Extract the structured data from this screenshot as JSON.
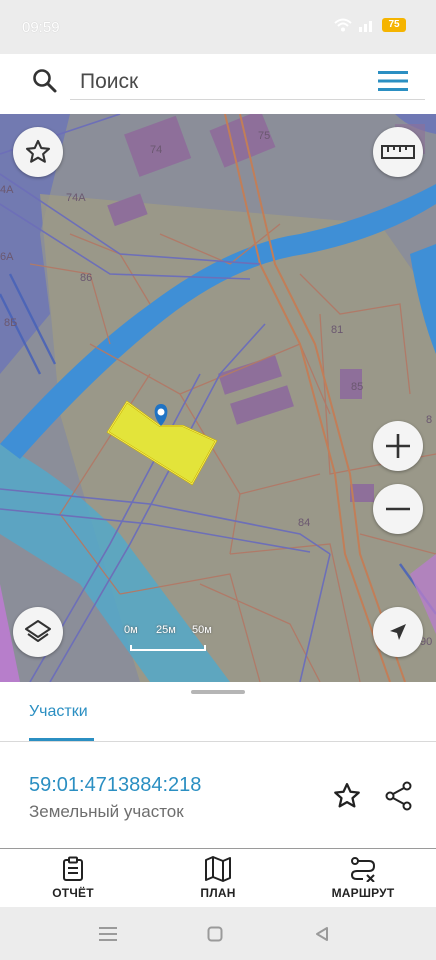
{
  "status_bar": {
    "time": "09:59",
    "battery": "75",
    "icons": [
      "wifi-icon",
      "signal-icon",
      "battery-icon"
    ]
  },
  "search": {
    "placeholder": "Поиск",
    "icon": "search-icon",
    "menu_icon": "hamburger-menu-icon"
  },
  "map": {
    "controls": [
      "favorite-star-icon",
      "ruler-icon",
      "zoom-in-icon",
      "zoom-out-icon",
      "layers-icon",
      "locate-arrow-icon"
    ],
    "labels": [
      "74",
      "75",
      "74А",
      "4А",
      "6А",
      "8Б",
      "86",
      "81",
      "85",
      "84",
      "90",
      "8"
    ],
    "scale": {
      "s0": "0м",
      "s1": "25м",
      "s2": "50м"
    },
    "marker_icon": "location-pin-icon",
    "colors": {
      "highlight": "#e3e43a",
      "water": "#3f8fd6",
      "roads": "#b07a68"
    }
  },
  "sheet": {
    "tab_label": "Участки",
    "parcel_number": "59:01:4713884:218",
    "parcel_type": "Земельный участок",
    "actions": [
      "star-icon",
      "share-icon"
    ]
  },
  "bottom_nav": {
    "report": "ОТЧЁТ",
    "plan": "ПЛАН",
    "route": "МАРШРУТ"
  },
  "accent_color": "#2b8fc2"
}
